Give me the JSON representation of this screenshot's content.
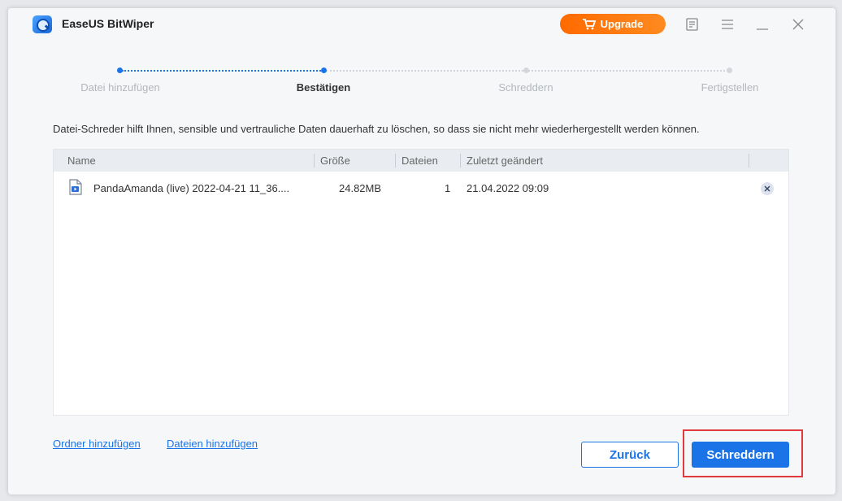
{
  "app": {
    "title": "EaseUS BitWiper",
    "upgrade_label": "Upgrade"
  },
  "titlebar_icons": [
    "feedback-icon",
    "menu-icon",
    "minimize-icon",
    "close-icon"
  ],
  "steps": [
    {
      "label": "Datei hinzufügen",
      "state": "done"
    },
    {
      "label": "Bestätigen",
      "state": "current"
    },
    {
      "label": "Schreddern",
      "state": "pending"
    },
    {
      "label": "Fertigstellen",
      "state": "pending"
    }
  ],
  "description": "Datei-Schreder hilft Ihnen, sensible und vertrauliche Daten dauerhaft zu löschen, so dass sie nicht mehr wiederhergestellt werden können.",
  "table": {
    "columns": [
      "Name",
      "Größe",
      "Dateien",
      "Zuletzt geändert"
    ],
    "rows": [
      {
        "name": "PandaAmanda (live) 2022-04-21 11_36....",
        "size": "24.82MB",
        "files": "1",
        "modified": "21.04.2022 09:09"
      }
    ]
  },
  "links": {
    "add_folder": "Ordner hinzufügen",
    "add_files": "Dateien hinzufügen"
  },
  "buttons": {
    "back": "Zurück",
    "shred": "Schreddern"
  },
  "colors": {
    "accent": "#1a74e8",
    "upgrade": "#ff7a10",
    "highlight": "#e0393e"
  }
}
